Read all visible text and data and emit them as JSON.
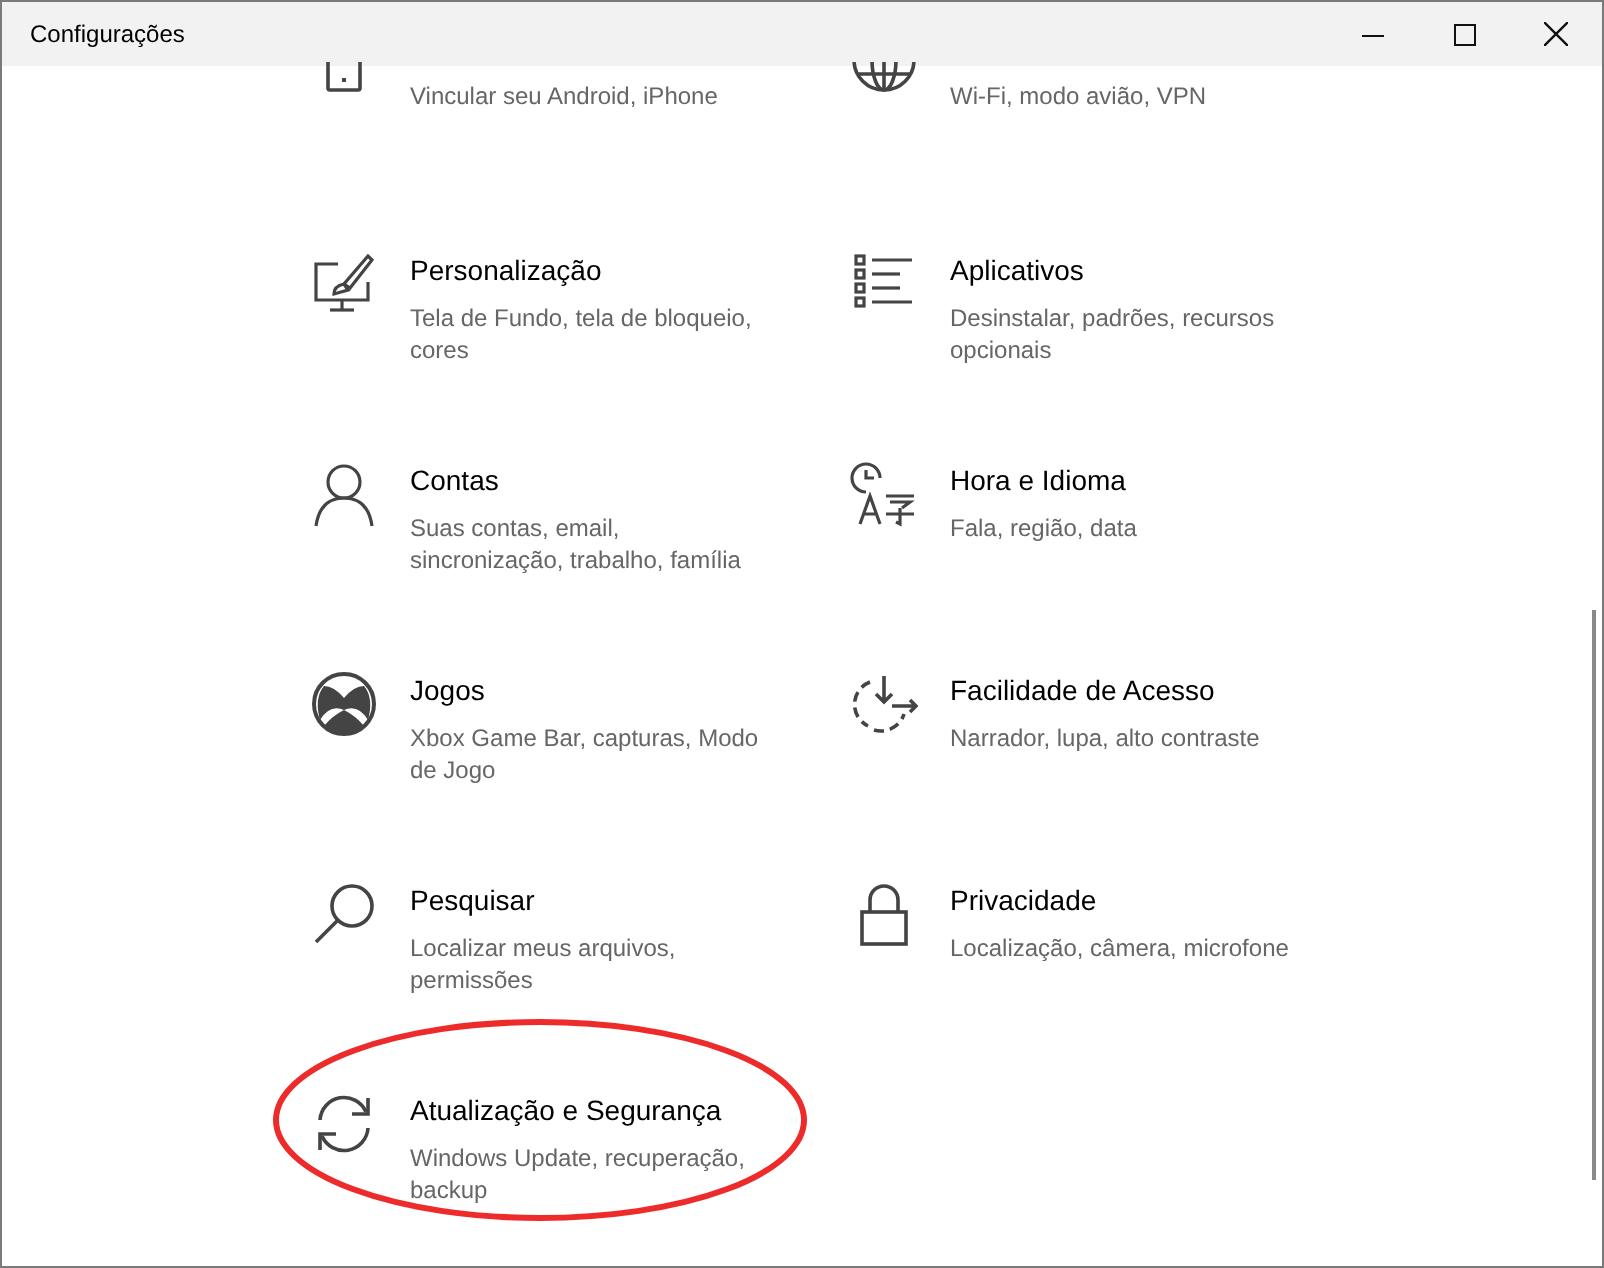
{
  "window": {
    "title": "Configurações"
  },
  "tiles": [
    {
      "kind": "clipped",
      "subtitle": "Vincular seu Android, iPhone",
      "highlighted": false
    },
    {
      "kind": "clipped",
      "subtitle": "Wi-Fi, modo avião, VPN",
      "highlighted": false
    },
    {
      "kind": "tile",
      "title": "Personalização",
      "subtitle": "Tela de Fundo, tela de bloqueio, cores",
      "highlighted": false
    },
    {
      "kind": "tile",
      "title": "Aplicativos",
      "subtitle": "Desinstalar, padrões, recursos opcionais",
      "highlighted": false
    },
    {
      "kind": "tile",
      "title": "Contas",
      "subtitle": "Suas contas, email, sincronização, trabalho, família",
      "highlighted": false
    },
    {
      "kind": "tile",
      "title": "Hora e Idioma",
      "subtitle": "Fala, região, data",
      "highlighted": false
    },
    {
      "kind": "tile",
      "title": "Jogos",
      "subtitle": "Xbox Game Bar, capturas, Modo de Jogo",
      "highlighted": false
    },
    {
      "kind": "tile",
      "title": "Facilidade de Acesso",
      "subtitle": "Narrador, lupa, alto contraste",
      "highlighted": false
    },
    {
      "kind": "tile",
      "title": "Pesquisar",
      "subtitle": "Localizar meus arquivos, permissões",
      "highlighted": false
    },
    {
      "kind": "tile",
      "title": "Privacidade",
      "subtitle": "Localização, câmera, microfone",
      "highlighted": false
    },
    {
      "kind": "tile",
      "title": "Atualização e Segurança",
      "subtitle": "Windows Update, recuperação, backup",
      "highlighted": true
    }
  ]
}
